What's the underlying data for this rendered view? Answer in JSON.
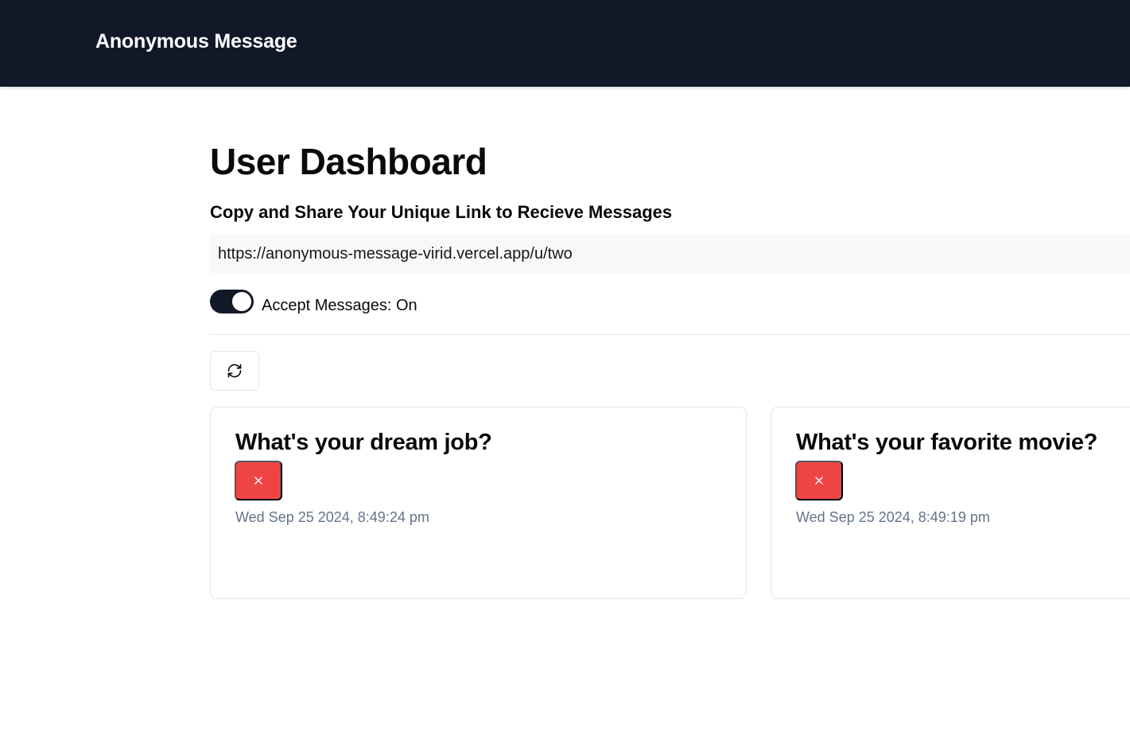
{
  "navbar": {
    "brand": "Anonymous Message"
  },
  "dashboard": {
    "title": "User Dashboard",
    "share_label": "Copy and Share Your Unique Link to Recieve Messages",
    "unique_link": "https://anonymous-message-virid.vercel.app/u/two",
    "accept_messages_label": "Accept Messages: On",
    "accept_messages_on": true
  },
  "messages": [
    {
      "content": "What's your dream job?",
      "date": "Wed Sep 25 2024, 8:49:24 pm"
    },
    {
      "content": "What's your favorite movie?",
      "date": "Wed Sep 25 2024, 8:49:19 pm"
    }
  ],
  "icons": {
    "refresh": "refresh-icon",
    "delete": "x-icon"
  },
  "colors": {
    "navbar_bg": "#111827",
    "delete_red": "#ef4444",
    "switch_on": "#111827",
    "muted_text": "#64748b"
  }
}
